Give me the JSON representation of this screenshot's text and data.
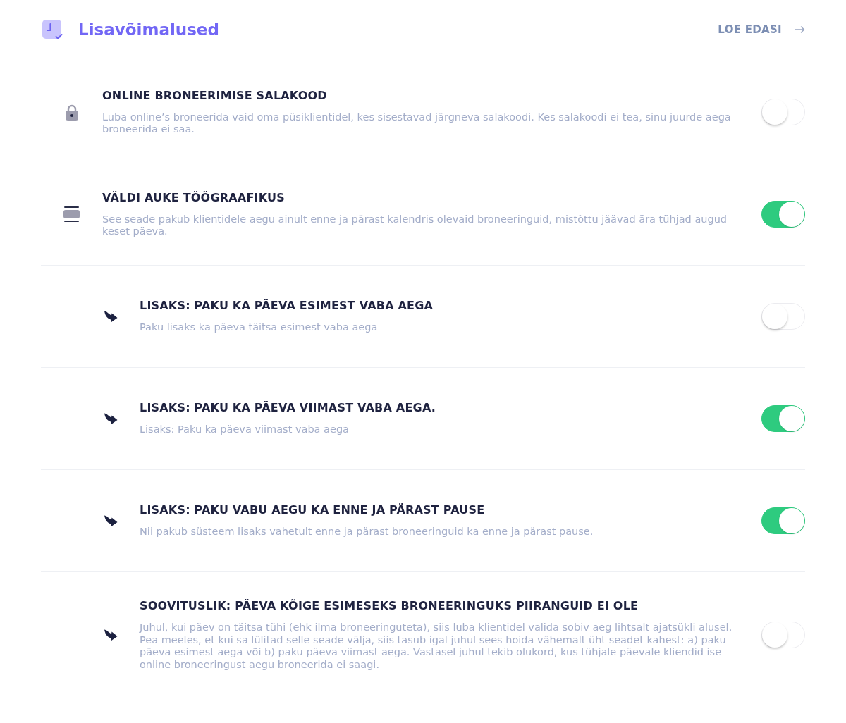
{
  "header": {
    "title": "Lisavõimalused",
    "link": {
      "label": "LOE EDASI"
    }
  },
  "settings": [
    {
      "title": "ONLINE BRONEERIMISE SALAKOOD",
      "description": "Luba online’s broneerida vaid oma püsiklientidel, kes sisestavad järgneva salakoodi. Kes salakoodi ei tea, sinu juurde aega broneerida ei saa.",
      "on": false
    },
    {
      "title": "VÄLDI AUKE TÖÖGRAAFIKUS",
      "description": "See seade pakub klientidele aegu ainult enne ja pärast kalendris olevaid broneeringuid, mistõttu jäävad ära tühjad augud keset päeva.",
      "on": true,
      "children": [
        {
          "title": "LISAKS: PAKU KA PÄEVA ESIMEST VABA AEGA",
          "description": "Paku lisaks ka päeva täitsa esimest vaba aega",
          "on": false
        },
        {
          "title": "LISAKS: PAKU KA PÄEVA VIIMAST VABA AEGA.",
          "description": "Lisaks: Paku ka päeva viimast vaba aega",
          "on": true
        },
        {
          "title": "LISAKS: PAKU VABU AEGU KA ENNE JA PÄRAST PAUSE",
          "description": "Nii pakub süsteem lisaks vahetult enne ja pärast broneeringuid ka enne ja pärast pause.",
          "on": true
        },
        {
          "title": "SOOVITUSLIK: PÄEVA KÕIGE ESIMESEKS BRONEERINGUKS PIIRANGUID EI OLE",
          "description": "Juhul, kui päev on täitsa tühi (ehk ilma broneeringuteta), siis luba klientidel valida sobiv aeg lihtsalt ajatsükli alusel. Pea meeles, et kui sa lülitad selle seade välja, siis tasub igal juhul sees hoida vähemalt üht seadet kahest: a) paku päeva esimest aega või b) paku päeva viimast aega. Vastasel juhul tekib olukord, kus tühjale päevale kliendid ise online broneeringust aegu broneerida ei saagi.",
          "on": false
        }
      ]
    }
  ]
}
